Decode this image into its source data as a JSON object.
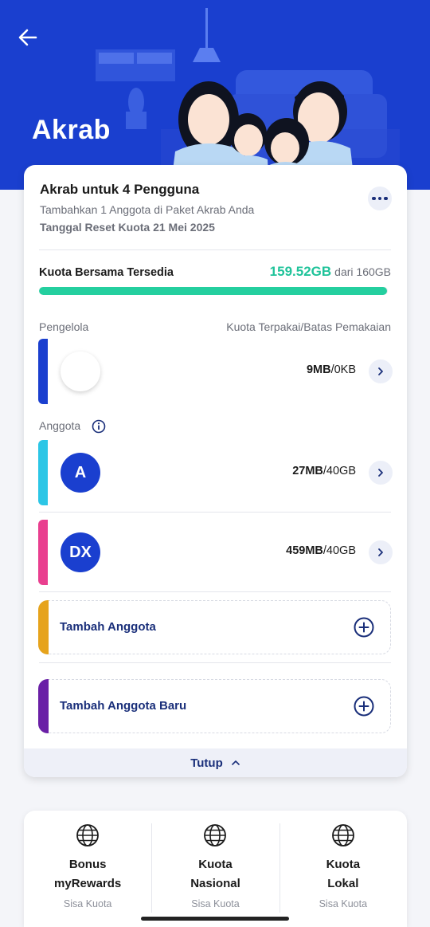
{
  "header": {
    "title": "Akrab",
    "back_icon": "arrow-left-icon",
    "background_color": "#1a3fcf"
  },
  "plan": {
    "name": "Akrab untuk 4 Pengguna",
    "subtitle": "Tambahkan 1 Anggota di Paket Akrab Anda",
    "reset": "Tanggal Reset Kuota 21 Mei 2025",
    "more_icon": "more-horizontal-icon"
  },
  "quota": {
    "label": "Kuota Bersama Tersedia",
    "available": "159.52GB",
    "total": "dari 160GB",
    "fraction_available": 0.997,
    "accent_color": "#1fc39a"
  },
  "managers": {
    "section_label": "Pengelola",
    "usage_header": "Kuota Terpakai/Batas Pemakaian",
    "items": [
      {
        "initials": "",
        "used": "9MB",
        "limit": "/0KB",
        "color": "#1a3fcf"
      }
    ]
  },
  "members": {
    "section_label": "Anggota",
    "info_icon": "info-icon",
    "items": [
      {
        "initials": "A",
        "used": "27MB",
        "limit": "/40GB",
        "color": "#2cc6e6"
      },
      {
        "initials": "DX",
        "used": "459MB",
        "limit": "/40GB",
        "color": "#e93f8f"
      }
    ]
  },
  "add_actions": [
    {
      "label": "Tambah Anggota",
      "color": "#e6a31c",
      "icon": "plus-circle-icon"
    },
    {
      "label": "Tambah Anggota Baru",
      "color": "#6a1fa6",
      "icon": "plus-circle-icon"
    }
  ],
  "footer": {
    "collapse_label": "Tutup",
    "collapse_icon": "chevron-up-icon"
  },
  "tiles": [
    {
      "title_line1": "Bonus",
      "title_line2": "myRewards",
      "subtitle": "Sisa Kuota",
      "icon": "globe-icon"
    },
    {
      "title_line1": "Kuota",
      "title_line2": "Nasional",
      "subtitle": "Sisa Kuota",
      "icon": "globe-icon"
    },
    {
      "title_line1": "Kuota",
      "title_line2": "Lokal",
      "subtitle": "Sisa Kuota",
      "icon": "globe-icon"
    }
  ]
}
